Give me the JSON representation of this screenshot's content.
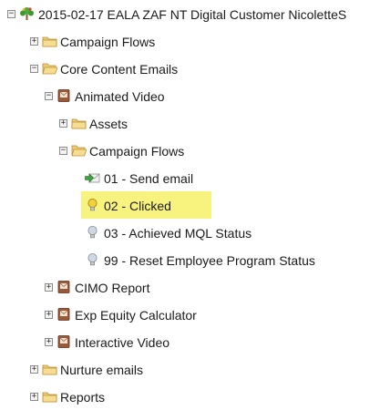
{
  "tree": {
    "program": "2015-02-17 EALA ZAF NT Digital Customer NicoletteS",
    "campaign_flows_top": "Campaign Flows",
    "core_content_emails": "Core Content Emails",
    "animated_video": "Animated Video",
    "assets": "Assets",
    "campaign_flows_inner": "Campaign Flows",
    "flow_01": "01 - Send email",
    "flow_02": "02 - Clicked",
    "flow_03": "03 - Achieved MQL Status",
    "flow_99": "99 - Reset Employee Program Status",
    "cimo_report": "CIMO Report",
    "exp_equity_calculator": "Exp Equity Calculator",
    "interactive_video": "Interactive Video",
    "nurture_emails": "Nurture emails",
    "reports": "Reports"
  },
  "toggles": {
    "expanded": "−",
    "collapsed": "+"
  },
  "colors": {
    "highlight": "#f8f27e",
    "folder": "#eccb72",
    "program_box": "#9a5a3a",
    "bulb": "#cfd8e3",
    "bulb_active": "#f2d23a",
    "send_arrow": "#3ea33e"
  }
}
